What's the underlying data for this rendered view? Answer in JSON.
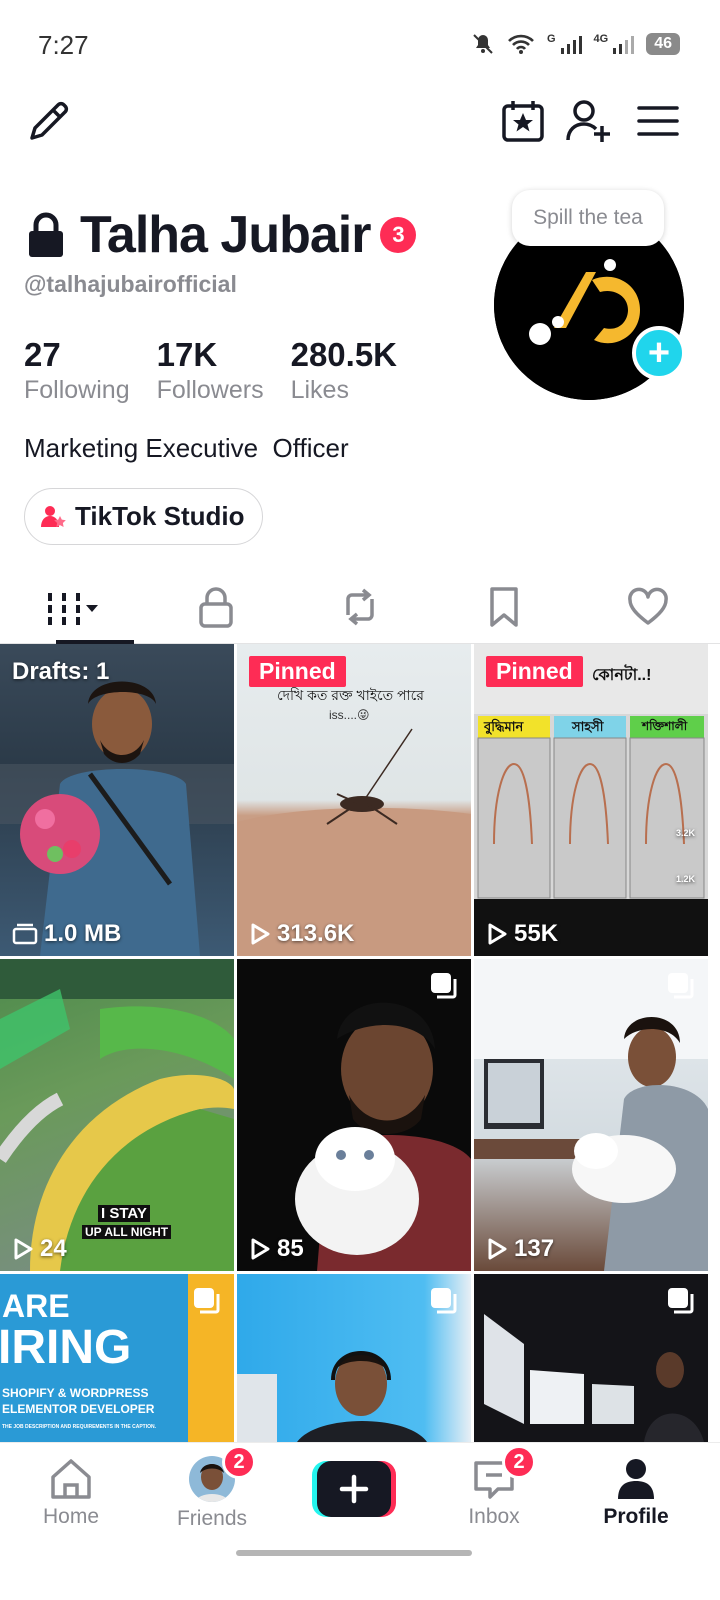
{
  "status_bar": {
    "time": "7:27",
    "network_1": "G",
    "network_2": "4G",
    "battery": "46"
  },
  "top_bar": {
    "icons": [
      "edit-icon",
      "calendar-star-icon",
      "add-friend-icon",
      "menu-icon"
    ]
  },
  "profile": {
    "name": "Talha Jubair",
    "notification_count": "3",
    "handle": "@talhajubairofficial",
    "stats": [
      {
        "value": "27",
        "label": "Following"
      },
      {
        "value": "17K",
        "label": "Followers"
      },
      {
        "value": "280.5K",
        "label": "Likes"
      }
    ],
    "bio": "Marketing Executive  Officer",
    "studio_button": "TikTok Studio",
    "avatar_bubble": "Spill the tea"
  },
  "tabs": [
    {
      "icon": "grid-icon",
      "active": true
    },
    {
      "icon": "lock-icon",
      "active": false
    },
    {
      "icon": "repost-icon",
      "active": false
    },
    {
      "icon": "bookmark-icon",
      "active": false
    },
    {
      "icon": "heart-icon",
      "active": false
    }
  ],
  "videos": [
    {
      "top_label": "Drafts: 1",
      "bottom_label": "1.0 MB",
      "type": "draft"
    },
    {
      "top_label": "Pinned",
      "bottom_label": "313.6K",
      "type": "pinned",
      "caption": "দেখি কত রক্ত খাইতে পারে",
      "caption2": "iss....😜"
    },
    {
      "top_label": "Pinned",
      "bottom_label": "55K",
      "type": "pinned",
      "caption": "কোনটা..!",
      "boxes": [
        "বুদ্ধিমান",
        "সাহসী",
        "শক্তিশালী"
      ],
      "side_counts": [
        "3.2K",
        "1.2K"
      ]
    },
    {
      "bottom_label": "24",
      "type": "video",
      "caption": "I STAY",
      "caption2": "UP ALL NIGHT"
    },
    {
      "bottom_label": "85",
      "type": "multi"
    },
    {
      "bottom_label": "137",
      "type": "multi"
    },
    {
      "type": "photo",
      "caption": "ARE",
      "caption2": "IRING",
      "caption3": "SHOPIFY & WORDPRESS",
      "caption4": "ELEMENTOR DEVELOPER",
      "caption5": "THE JOB DESCRIPTION AND REQUIREMENTS IN THE CAPTION."
    },
    {
      "type": "multi"
    },
    {
      "type": "multi"
    }
  ],
  "bottom_nav": {
    "home": "Home",
    "friends": "Friends",
    "friends_badge": "2",
    "inbox": "Inbox",
    "inbox_badge": "2",
    "profile": "Profile"
  },
  "colors": {
    "accent_red": "#fe2c55",
    "accent_cyan": "#20d5ec",
    "text_primary": "#161823",
    "text_secondary": "#8a8b91"
  }
}
